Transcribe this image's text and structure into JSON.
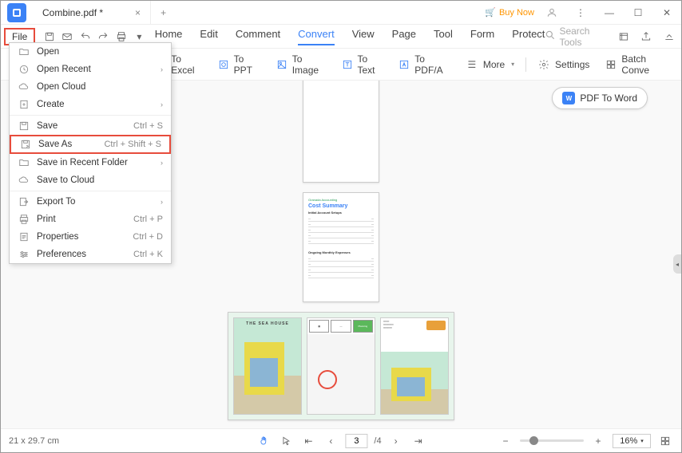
{
  "titlebar": {
    "tab_title": "Combine.pdf *",
    "buy_now": "Buy Now"
  },
  "toolbar": {
    "file": "File"
  },
  "menu_tabs": {
    "home": "Home",
    "edit": "Edit",
    "comment": "Comment",
    "convert": "Convert",
    "view": "View",
    "page": "Page",
    "tool": "Tool",
    "form": "Form",
    "protect": "Protect"
  },
  "search_placeholder": "Search Tools",
  "ribbon": {
    "to_excel": "To Excel",
    "to_ppt": "To PPT",
    "to_image": "To Image",
    "to_text": "To Text",
    "to_pdfa": "To PDF/A",
    "more": "More",
    "settings": "Settings",
    "batch_convert": "Batch Conve"
  },
  "file_menu": {
    "open": "Open",
    "open_recent": "Open Recent",
    "open_cloud": "Open Cloud",
    "create": "Create",
    "save": "Save",
    "save_shortcut": "Ctrl + S",
    "save_as": "Save As",
    "save_as_shortcut": "Ctrl + Shift + S",
    "save_recent": "Save in Recent Folder",
    "save_cloud": "Save to Cloud",
    "export_to": "Export To",
    "print": "Print",
    "print_shortcut": "Ctrl + P",
    "properties": "Properties",
    "properties_shortcut": "Ctrl + D",
    "preferences": "Preferences",
    "preferences_shortcut": "Ctrl + K"
  },
  "pdf_to_word": "PDF To Word",
  "page2": {
    "header": "Granada Accounting",
    "title": "Cost Summary",
    "sub1": "Initial Account Setups",
    "sub2": "Ongoing Monthly Expenses"
  },
  "page3": {
    "title": "THE SEA HOUSE",
    "box_label": "Planning"
  },
  "statusbar": {
    "dimensions": "21 x 29.7 cm",
    "current_page": "3",
    "total_pages": "/4",
    "zoom": "16%"
  }
}
